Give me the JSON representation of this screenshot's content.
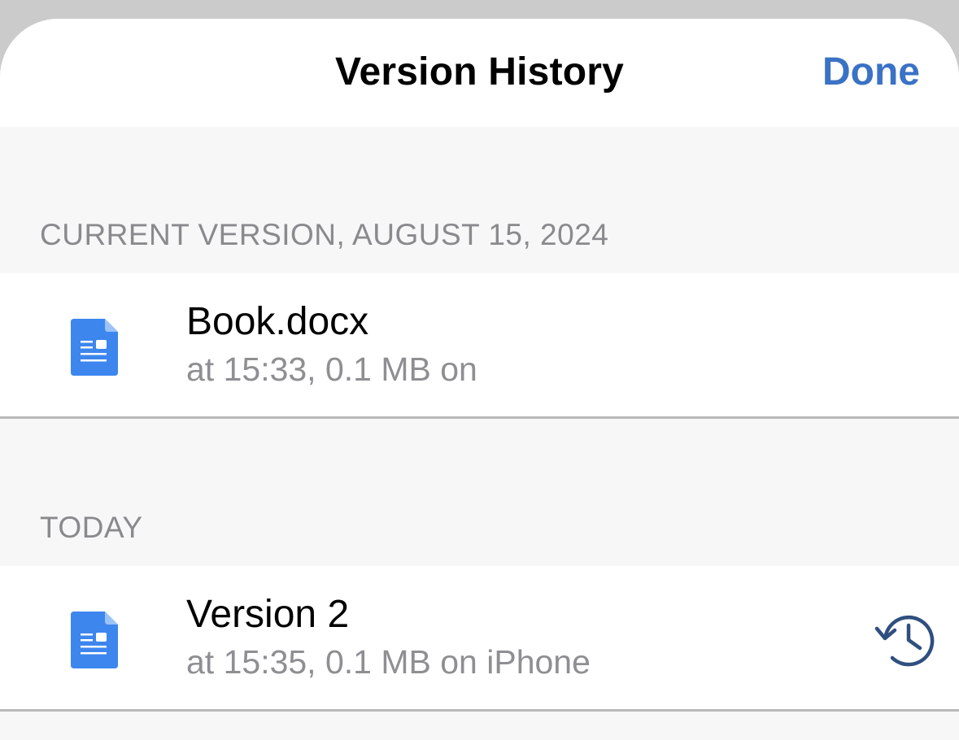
{
  "header": {
    "title": "Version History",
    "done_label": "Done"
  },
  "sections": [
    {
      "header": "CURRENT VERSION, AUGUST 15, 2024",
      "items": [
        {
          "icon": "document-icon",
          "title": "Book.docx",
          "subtitle": "at 15:33, 0.1 MB on"
        }
      ]
    },
    {
      "header": "TODAY",
      "items": [
        {
          "icon": "document-icon",
          "title": "Version 2",
          "subtitle": "at 15:35, 0.1 MB on iPhone",
          "action_icon": "restore-history-icon"
        }
      ]
    }
  ],
  "colors": {
    "accent": "#3a72c5",
    "doc_icon": "#3d86ee",
    "restore_icon": "#2f4f7f"
  }
}
